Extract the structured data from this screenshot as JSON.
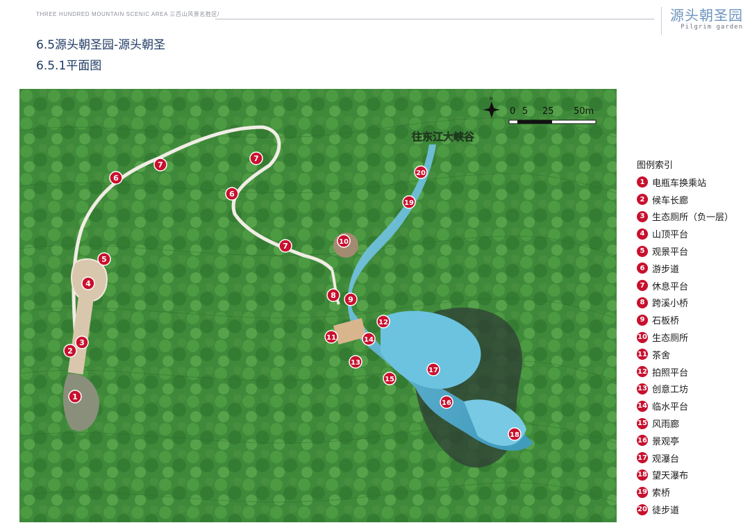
{
  "header": {
    "text": "THREE HUNDRED MOUNTAIN SCENIC AREA 三百山风景名胜区/",
    "brand_title": "源头朝圣园",
    "brand_sub": "Pilgrim garden"
  },
  "titles": {
    "section": "6.5源头朝圣园-源头朝圣",
    "sub": "6.5.1平面图"
  },
  "map": {
    "direction_label": "往东江大峡谷",
    "scale": [
      "0",
      "5",
      "25",
      "50m"
    ],
    "colors": {
      "forest": "#3f8a3a",
      "water": "#5ab4d6",
      "path": "#e9e4da",
      "marker": "#c8102e"
    }
  },
  "legend": {
    "title": "图例索引",
    "items": [
      {
        "num": "1",
        "label": "电瓶车换乘站"
      },
      {
        "num": "2",
        "label": "候车长廊"
      },
      {
        "num": "3",
        "label": "生态厕所（负一层）"
      },
      {
        "num": "4",
        "label": "山顶平台"
      },
      {
        "num": "5",
        "label": "观景平台"
      },
      {
        "num": "6",
        "label": "游步道"
      },
      {
        "num": "7",
        "label": "休息平台"
      },
      {
        "num": "8",
        "label": "跨溪小桥"
      },
      {
        "num": "9",
        "label": "石板桥"
      },
      {
        "num": "10",
        "label": "生态厕所"
      },
      {
        "num": "11",
        "label": "茶舍"
      },
      {
        "num": "12",
        "label": "拍照平台"
      },
      {
        "num": "13",
        "label": "创意工坊"
      },
      {
        "num": "14",
        "label": "临水平台"
      },
      {
        "num": "15",
        "label": "风雨廊"
      },
      {
        "num": "16",
        "label": "景观亭"
      },
      {
        "num": "17",
        "label": "观瀑台"
      },
      {
        "num": "18",
        "label": "望天瀑布"
      },
      {
        "num": "19",
        "label": "索桥"
      },
      {
        "num": "20",
        "label": "徒步道"
      }
    ]
  }
}
